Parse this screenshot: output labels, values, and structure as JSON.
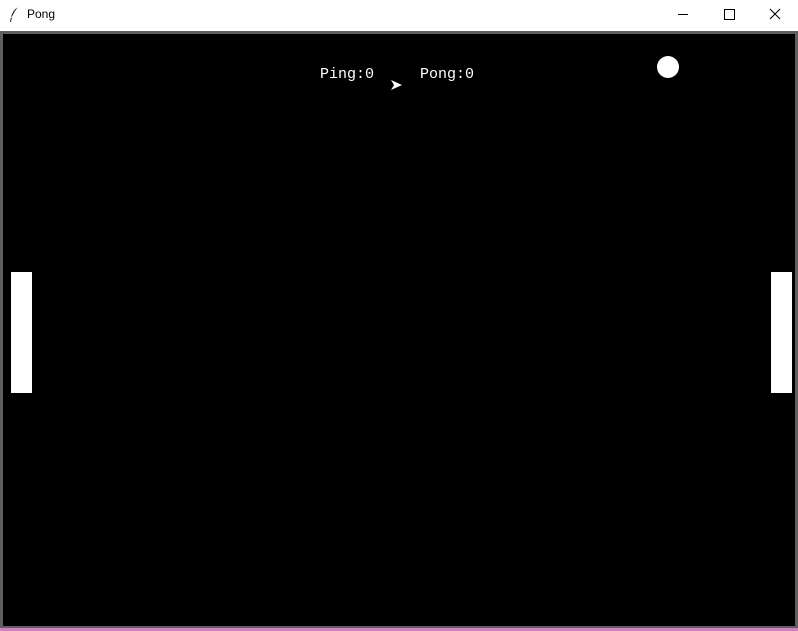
{
  "window": {
    "title": "Pong",
    "icons": {
      "app": "feather-icon",
      "minimize": "minimize-icon",
      "maximize": "maximize-icon",
      "close": "close-icon"
    }
  },
  "game": {
    "score": {
      "ping_text": "Ping:0",
      "pong_text": "Pong:0"
    },
    "colors": {
      "background": "#000000",
      "foreground": "#ffffff"
    },
    "icons": {
      "turtle": "arrow-cursor-icon"
    }
  }
}
